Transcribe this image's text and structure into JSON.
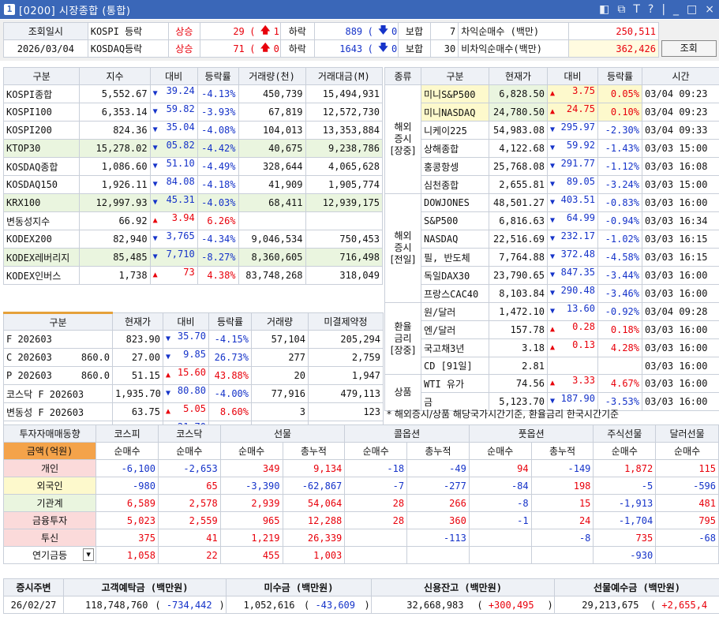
{
  "window": {
    "title_icon": "1",
    "title": "[0200] 시장종합 (통합)",
    "controls": [
      "◧",
      "⧉",
      "T",
      "?",
      "|",
      "_",
      "□",
      "×"
    ]
  },
  "summary": {
    "lookup_label": "조회일시",
    "date": "2026/03/04",
    "rows": [
      {
        "market": "KOSPI 등락",
        "rise_label": "상승",
        "rise": "29",
        "up_mark": "1",
        "fall_label": "하락",
        "fall": "889",
        "down_mark": "0",
        "flat_label": "보합",
        "flat": "7"
      },
      {
        "market": "KOSDAQ등락",
        "rise_label": "상승",
        "rise": "71",
        "up_mark": "0",
        "fall_label": "하락",
        "fall": "1643",
        "down_mark": "0",
        "flat_label": "보합",
        "flat": "30"
      }
    ],
    "arb_label": "차익순매수   (백만)",
    "arb": "250,511",
    "nonarb_label": "비차익순매수(백만)",
    "nonarb": "362,426",
    "query_button": "조회"
  },
  "index_table": {
    "headers": [
      "구분",
      "지수",
      "대비",
      "등락률",
      "거래량(천)",
      "거래대금(M)"
    ],
    "rows": [
      {
        "name": "KOSPI종합",
        "value": "5,552.67",
        "dir": "dn",
        "chg": "39.24",
        "rate": "-4.13%",
        "vol": "450,739",
        "amt": "15,494,931"
      },
      {
        "name": "KOSPI100",
        "value": "6,353.14",
        "dir": "dn",
        "chg": "59.82",
        "rate": "-3.93%",
        "vol": "67,819",
        "amt": "12,572,730"
      },
      {
        "name": "KOSPI200",
        "value": "824.36",
        "dir": "dn",
        "chg": "35.04",
        "rate": "-4.08%",
        "vol": "104,013",
        "amt": "13,353,884"
      },
      {
        "name": "KTOP30",
        "value": "15,278.02",
        "dir": "dn",
        "chg": "05.82",
        "rate": "-4.42%",
        "vol": "40,675",
        "amt": "9,238,786"
      },
      {
        "name": "KOSDAQ종합",
        "value": "1,086.60",
        "dir": "dn",
        "chg": "51.10",
        "rate": "-4.49%",
        "vol": "328,644",
        "amt": "4,065,628"
      },
      {
        "name": "KOSDAQ150",
        "value": "1,926.11",
        "dir": "dn",
        "chg": "84.08",
        "rate": "-4.18%",
        "vol": "41,909",
        "amt": "1,905,774"
      },
      {
        "name": "KRX100",
        "value": "12,997.93",
        "dir": "dn",
        "chg": "45.31",
        "rate": "-4.03%",
        "vol": "68,411",
        "amt": "12,939,175"
      },
      {
        "name": "변동성지수",
        "value": "66.92",
        "dir": "up",
        "chg": "3.94",
        "rate": "6.26%",
        "vol": "",
        "amt": ""
      },
      {
        "name": "KODEX200",
        "value": "82,940",
        "dir": "dn",
        "chg": "3,765",
        "rate": "-4.34%",
        "vol": "9,046,534",
        "amt": "750,453"
      },
      {
        "name": "KODEX레버리지",
        "value": "85,485",
        "dir": "dn",
        "chg": "7,710",
        "rate": "-8.27%",
        "vol": "8,360,605",
        "amt": "716,498"
      },
      {
        "name": "KODEX인버스",
        "value": "1,738",
        "dir": "up",
        "chg": "73",
        "rate": "4.38%",
        "vol": "83,748,268",
        "amt": "318,049"
      }
    ]
  },
  "futures_table": {
    "headers": [
      "구분",
      "현재가",
      "대비",
      "등락률",
      "거래량",
      "미결제약정"
    ],
    "rows": [
      {
        "name": "F 202603",
        "strike": "",
        "value": "823.90",
        "dir": "dn",
        "chg": "35.70",
        "rate": "-4.15%",
        "vol": "57,104",
        "oi": "205,294"
      },
      {
        "name": "C 202603",
        "strike": "860.0",
        "value": "27.00",
        "dir": "dn",
        "chg": "9.85",
        "rate": "26.73%",
        "vol": "277",
        "oi": "2,759"
      },
      {
        "name": "P 202603",
        "strike": "860.0",
        "value": "51.15",
        "dir": "up",
        "chg": "15.60",
        "rate": "43.88%",
        "vol": "20",
        "oi": "1,947"
      },
      {
        "name": "코스닥 F 202603",
        "strike": "",
        "value": "1,935.70",
        "dir": "dn",
        "chg": "80.80",
        "rate": "-4.00%",
        "vol": "77,916",
        "oi": "479,113"
      },
      {
        "name": "변동성 F 202603",
        "strike": "",
        "value": "63.75",
        "dir": "up",
        "chg": "5.05",
        "rate": "8.60%",
        "vol": "3",
        "oi": "123"
      },
      {
        "name": "야간F 202603",
        "strike": "",
        "value": "837.90",
        "dir": "dn",
        "chg": "21.70",
        "rate": "-2.52%",
        "vol": "59,365",
        "oi": "203,847"
      }
    ]
  },
  "global_table": {
    "headers": [
      "종류",
      "구분",
      "현재가",
      "대비",
      "등락률",
      "시간"
    ],
    "groups": [
      {
        "label": "해외\n증시\n[장중]",
        "rows": [
          {
            "name": "미니S&P500",
            "value": "6,828.50",
            "dir": "up",
            "chg": "3.75",
            "rate": "0.05%",
            "time": "03/04 09:23"
          },
          {
            "name": "미니NASDAQ",
            "value": "24,780.50",
            "dir": "up",
            "chg": "24.75",
            "rate": "0.10%",
            "time": "03/04 09:23"
          },
          {
            "name": "니케이225",
            "value": "54,983.08",
            "dir": "dn",
            "chg": "295.97",
            "rate": "-2.30%",
            "time": "03/04 09:33"
          },
          {
            "name": "상해종합",
            "value": "4,122.68",
            "dir": "dn",
            "chg": "59.92",
            "rate": "-1.43%",
            "time": "03/03 15:00"
          },
          {
            "name": "홍콩항셍",
            "value": "25,768.08",
            "dir": "dn",
            "chg": "291.77",
            "rate": "-1.12%",
            "time": "03/03 16:08"
          },
          {
            "name": "심천종합",
            "value": "2,655.81",
            "dir": "dn",
            "chg": "89.05",
            "rate": "-3.24%",
            "time": "03/03 15:00"
          }
        ]
      },
      {
        "label": "해외\n증시\n[전일]",
        "rows": [
          {
            "name": "DOWJONES",
            "value": "48,501.27",
            "dir": "dn",
            "chg": "403.51",
            "rate": "-0.83%",
            "time": "03/03 16:00"
          },
          {
            "name": "S&P500",
            "value": "6,816.63",
            "dir": "dn",
            "chg": "64.99",
            "rate": "-0.94%",
            "time": "03/03 16:34"
          },
          {
            "name": "NASDAQ",
            "value": "22,516.69",
            "dir": "dn",
            "chg": "232.17",
            "rate": "-1.02%",
            "time": "03/03 16:15"
          },
          {
            "name": "필, 반도체",
            "value": "7,764.88",
            "dir": "dn",
            "chg": "372.48",
            "rate": "-4.58%",
            "time": "03/03 16:15"
          },
          {
            "name": "독일DAX30",
            "value": "23,790.65",
            "dir": "dn",
            "chg": "847.35",
            "rate": "-3.44%",
            "time": "03/03 16:00"
          },
          {
            "name": "프랑스CAC40",
            "value": "8,103.84",
            "dir": "dn",
            "chg": "290.48",
            "rate": "-3.46%",
            "time": "03/03 16:00"
          }
        ]
      },
      {
        "label": "환율\n금리\n[장중]",
        "rows": [
          {
            "name": "원/달러",
            "value": "1,472.10",
            "dir": "dn",
            "chg": "13.60",
            "rate": "-0.92%",
            "time": "03/04 09:28"
          },
          {
            "name": "엔/달러",
            "value": "157.78",
            "dir": "up",
            "chg": "0.28",
            "rate": "0.18%",
            "time": "03/03 16:00"
          },
          {
            "name": "국고채3년",
            "value": "3.18",
            "dir": "up",
            "chg": "0.13",
            "rate": "4.28%",
            "time": "03/03 16:00"
          },
          {
            "name": "CD [91일]",
            "value": "2.81",
            "dir": "",
            "chg": "",
            "rate": "",
            "time": "03/03 16:00"
          }
        ]
      },
      {
        "label": "상품",
        "rows": [
          {
            "name": "WTI 유가",
            "value": "74.56",
            "dir": "up",
            "chg": "3.33",
            "rate": "4.67%",
            "time": "03/03 16:00"
          },
          {
            "name": "금",
            "value": "5,123.70",
            "dir": "dn",
            "chg": "187.90",
            "rate": "-3.53%",
            "time": "03/03 16:00"
          }
        ]
      }
    ],
    "note": "* 해외증시/상품 해당국가시간기준, 환율금리 한국시간기준"
  },
  "investor_table": {
    "title": "투자자매매동향",
    "unit": "금액(억원)",
    "groups": [
      "코스피",
      "코스닥",
      "선물",
      "콜옵션",
      "풋옵션",
      "주식선물",
      "달러선물"
    ],
    "subheaders": [
      "순매수",
      "순매수",
      "순매수",
      "총누적",
      "순매수",
      "총누적",
      "순매수",
      "총누적",
      "순매수",
      "순매수"
    ],
    "rows": [
      {
        "name": "개인",
        "cells": [
          "-6,100",
          "-2,653",
          "349",
          "9,134",
          "-18",
          "-49",
          "94",
          "-149",
          "1,872",
          "115"
        ]
      },
      {
        "name": "외국인",
        "cells": [
          "-980",
          "65",
          "-3,390",
          "-62,867",
          "-7",
          "-277",
          "-84",
          "198",
          "-5",
          "-596"
        ]
      },
      {
        "name": "기관계",
        "cells": [
          "6,589",
          "2,578",
          "2,939",
          "54,064",
          "28",
          "266",
          "-8",
          "15",
          "-1,913",
          "481"
        ]
      },
      {
        "name": "금융투자",
        "cells": [
          "5,023",
          "2,559",
          "965",
          "12,288",
          "28",
          "360",
          "-1",
          "24",
          "-1,704",
          "795"
        ]
      },
      {
        "name": "투신",
        "cells": [
          "375",
          "41",
          "1,219",
          "26,339",
          "",
          "-113",
          "",
          "-8",
          "735",
          "-68"
        ]
      },
      {
        "name": "연기금등",
        "cells": [
          "1,058",
          "22",
          "455",
          "1,003",
          "",
          "",
          "",
          "",
          "-930",
          ""
        ]
      }
    ]
  },
  "bottom": {
    "headers": [
      "증시주변",
      "고객예탁금 (백만원)",
      "미수금 (백만원)",
      "신용잔고 (백만원)",
      "선물예수금 (백만원)"
    ],
    "date": "26/02/27",
    "deposit": "118,748,760",
    "deposit_chg": "-734,442",
    "unpaid": "1,052,616",
    "unpaid_chg": "-43,609",
    "credit": "32,668,983",
    "credit_chg": "+300,495",
    "fut_dep": "29,213,675",
    "fut_dep_chg": "+2,655,4"
  }
}
